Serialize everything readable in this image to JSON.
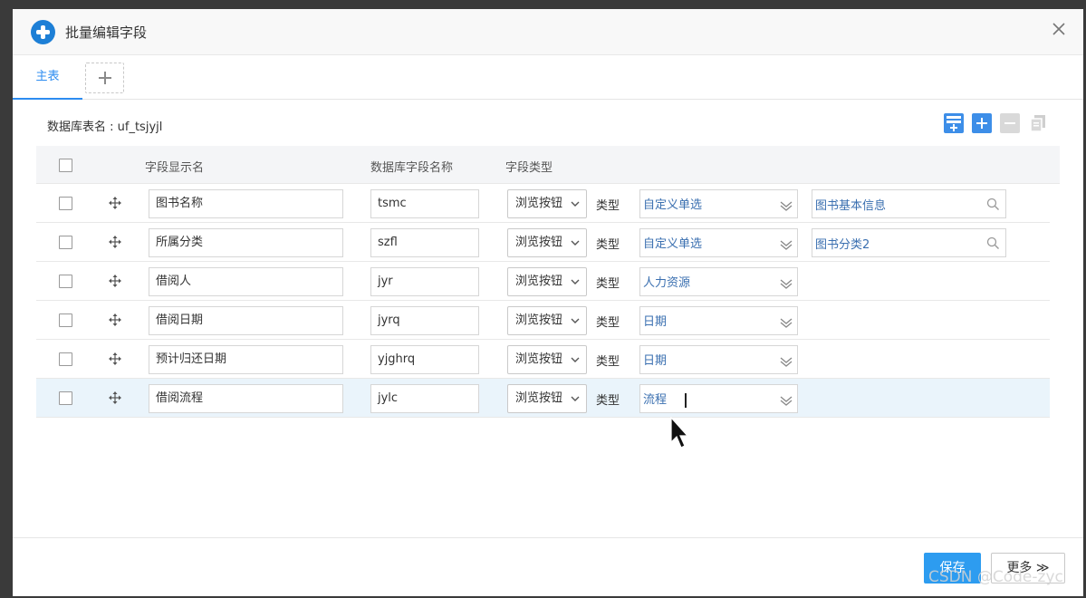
{
  "dialog": {
    "title": "批量编辑字段"
  },
  "tabs": {
    "main_label": "主表"
  },
  "db_table_label": "数据库表名 : uf_tsjyjl",
  "grid": {
    "columns": {
      "display_name": "字段显示名",
      "db_field_name": "数据库字段名称",
      "field_type": "字段类型"
    },
    "rows": [
      {
        "display_name": "图书名称",
        "db_field": "tsmc",
        "field_type": "浏览按钮",
        "type_label": "类型",
        "type_value": "自定义单选",
        "ref_value": "图书基本信息"
      },
      {
        "display_name": "所属分类",
        "db_field": "szfl",
        "field_type": "浏览按钮",
        "type_label": "类型",
        "type_value": "自定义单选",
        "ref_value": "图书分类2"
      },
      {
        "display_name": "借阅人",
        "db_field": "jyr",
        "field_type": "浏览按钮",
        "type_label": "类型",
        "type_value": "人力资源"
      },
      {
        "display_name": "借阅日期",
        "db_field": "jyrq",
        "field_type": "浏览按钮",
        "type_label": "类型",
        "type_value": "日期"
      },
      {
        "display_name": "预计归还日期",
        "db_field": "yjghrq",
        "field_type": "浏览按钮",
        "type_label": "类型",
        "type_value": "日期"
      },
      {
        "display_name": "借阅流程",
        "db_field": "jylc",
        "field_type": "浏览按钮",
        "type_label": "类型",
        "type_value": "流程"
      }
    ]
  },
  "footer": {
    "save_label": "保存",
    "more_label": "更多 ≫"
  },
  "watermark": "CSDN @Code-zyc",
  "colors": {
    "accent": "#2d8cf0",
    "save_button": "#2d9cf0",
    "link_text": "#3a6fb0",
    "selected_row": "#eaf4fb"
  }
}
